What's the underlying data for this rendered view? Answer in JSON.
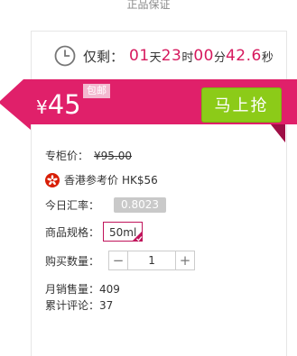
{
  "top": {
    "label": "正品保证"
  },
  "countdown": {
    "label": "仅剩：",
    "days": "01",
    "days_unit": "天",
    "hours": "23",
    "hours_unit": "时",
    "minutes": "00",
    "minutes_unit": "分",
    "seconds": "42.6",
    "seconds_unit": "秒"
  },
  "price": {
    "symbol": "¥",
    "value": "45",
    "free_shipping": "包邮"
  },
  "buy_button": {
    "label": "马上抢"
  },
  "details": {
    "counter_price_label": "专柜价：",
    "counter_price": "¥95.00",
    "hk_ref_label": "香港参考价",
    "hk_ref_price": "HK$56",
    "rate_label": "今日汇率：",
    "rate_value": "0.8023",
    "spec_label": "商品规格：",
    "spec_value": "50ml",
    "qty_label": "购买数量：",
    "qty_value": "1",
    "qty_minus": "−",
    "qty_plus": "+",
    "monthly_sales": "月销售量：409",
    "total_reviews": "累计评论：37"
  },
  "colors": {
    "brand": "#d6195e",
    "buy": "#8ccb18",
    "price_band": "#e0206a"
  }
}
